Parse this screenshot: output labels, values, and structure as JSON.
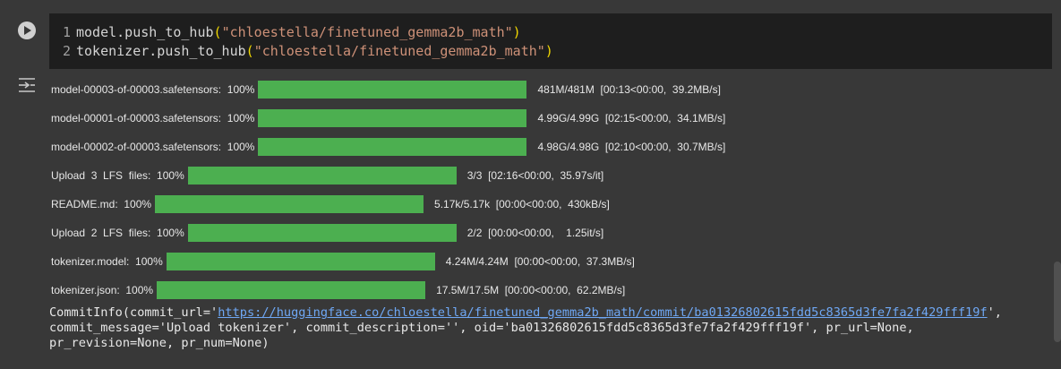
{
  "cell": {
    "code_lines": [
      {
        "num": "1",
        "prefix": "model.push_to_hub",
        "open": "(",
        "arg": "\"chloestella/finetuned_gemma2b_math\"",
        "close": ")"
      },
      {
        "num": "2",
        "prefix": "tokenizer.push_to_hub",
        "open": "(",
        "arg": "\"chloestella/finetuned_gemma2b_math\"",
        "close": ")"
      }
    ]
  },
  "progress_rows": [
    {
      "label": "model-00003-of-00003.safetensors:  100%",
      "fraction": 1.0,
      "stats": "481M/481M  [00:13<00:00,  39.2MB/s]"
    },
    {
      "label": "model-00001-of-00003.safetensors:  100%",
      "fraction": 1.0,
      "stats": "4.99G/4.99G  [02:15<00:00,  34.1MB/s]"
    },
    {
      "label": "model-00002-of-00003.safetensors:  100%",
      "fraction": 1.0,
      "stats": "4.98G/4.98G  [02:10<00:00,  30.7MB/s]"
    },
    {
      "label": "Upload  3  LFS  files:  100%",
      "fraction": 1.0,
      "stats": "3/3  [02:16<00:00,  35.97s/it]"
    },
    {
      "label": "README.md:  100%",
      "fraction": 1.0,
      "stats": "5.17k/5.17k  [00:00<00:00,  430kB/s]"
    },
    {
      "label": "Upload  2  LFS  files:  100%",
      "fraction": 1.0,
      "stats": "2/2  [00:00<00:00,    1.25it/s]"
    },
    {
      "label": "tokenizer.model:  100%",
      "fraction": 1.0,
      "stats": "4.24M/4.24M  [00:00<00:00,  37.3MB/s]"
    },
    {
      "label": "tokenizer.json:  100%",
      "fraction": 1.0,
      "stats": "17.5M/17.5M  [00:00<00:00,  62.2MB/s]"
    }
  ],
  "commit": {
    "line1_prefix": "CommitInfo(commit_url='",
    "url": "https://huggingface.co/chloestella/finetuned_gemma2b_math/commit/ba01326802615fdd5c8365d3fe7fa2f429fff19f",
    "line1_suffix": "',",
    "line2": "commit_message='Upload tokenizer', commit_description='', oid='ba01326802615fdd5c8365d3fe7fa2f429fff19f', pr_url=None,",
    "line3": "pr_revision=None, pr_num=None)"
  },
  "colors": {
    "progress": "#4caf50",
    "link": "#6fa8f5",
    "string": "#ce9178",
    "paren": "#f1d700"
  },
  "icons": {
    "run": "play-circle-icon",
    "output": "output-toggle-icon"
  }
}
